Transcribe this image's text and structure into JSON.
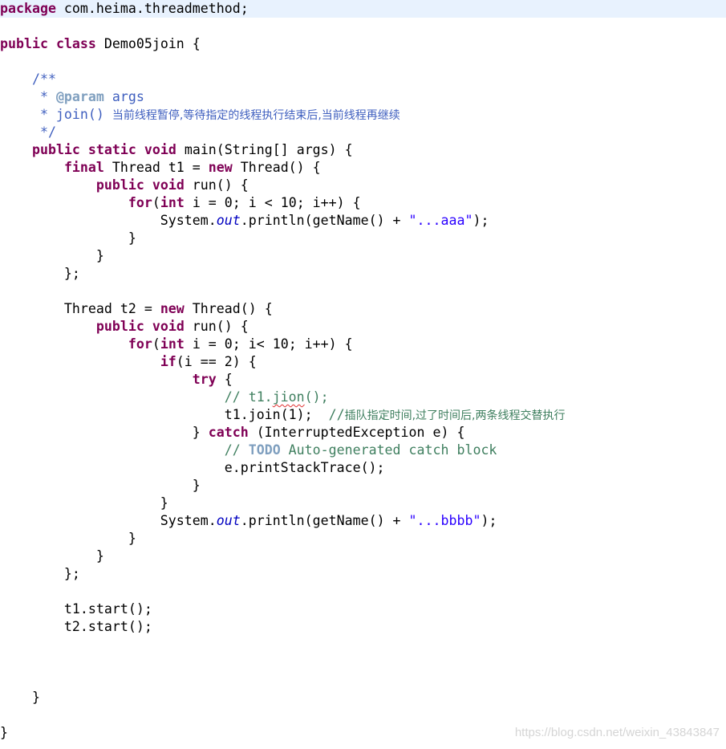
{
  "editor": {
    "lines": [
      {
        "highlight": true,
        "segs": [
          {
            "c": "kw",
            "t": "package"
          },
          {
            "c": "",
            "t": " com.heima.threadmethod;"
          }
        ]
      },
      {
        "segs": []
      },
      {
        "segs": [
          {
            "c": "kw",
            "t": "public"
          },
          {
            "c": "",
            "t": " "
          },
          {
            "c": "kw",
            "t": "class"
          },
          {
            "c": "",
            "t": " Demo05join {"
          }
        ]
      },
      {
        "segs": []
      },
      {
        "segs": [
          {
            "c": "jd",
            "t": "    /**"
          }
        ]
      },
      {
        "segs": [
          {
            "c": "jd",
            "t": "     * "
          },
          {
            "c": "tag",
            "t": "@param"
          },
          {
            "c": "jd",
            "t": " args"
          }
        ]
      },
      {
        "segs": [
          {
            "c": "jd",
            "t": "     * join() "
          },
          {
            "c": "jd cjk",
            "t": "当前线程暂停,等待指定的线程执行结束后,当前线程再继续"
          }
        ]
      },
      {
        "segs": [
          {
            "c": "jd",
            "t": "     */"
          }
        ]
      },
      {
        "segs": [
          {
            "c": "",
            "t": "    "
          },
          {
            "c": "kw",
            "t": "public"
          },
          {
            "c": "",
            "t": " "
          },
          {
            "c": "kw",
            "t": "static"
          },
          {
            "c": "",
            "t": " "
          },
          {
            "c": "kw",
            "t": "void"
          },
          {
            "c": "",
            "t": " main(String[] args) {"
          }
        ]
      },
      {
        "segs": [
          {
            "c": "",
            "t": "        "
          },
          {
            "c": "kw",
            "t": "final"
          },
          {
            "c": "",
            "t": " Thread t1 = "
          },
          {
            "c": "kw",
            "t": "new"
          },
          {
            "c": "",
            "t": " Thread() {"
          }
        ]
      },
      {
        "segs": [
          {
            "c": "",
            "t": "            "
          },
          {
            "c": "kw",
            "t": "public"
          },
          {
            "c": "",
            "t": " "
          },
          {
            "c": "kw",
            "t": "void"
          },
          {
            "c": "",
            "t": " run() {"
          }
        ]
      },
      {
        "segs": [
          {
            "c": "",
            "t": "                "
          },
          {
            "c": "kw",
            "t": "for"
          },
          {
            "c": "",
            "t": "("
          },
          {
            "c": "kw",
            "t": "int"
          },
          {
            "c": "",
            "t": " i = 0; i < 10; i++) {"
          }
        ]
      },
      {
        "segs": [
          {
            "c": "",
            "t": "                    System."
          },
          {
            "c": "fld",
            "t": "out"
          },
          {
            "c": "",
            "t": ".println(getName() + "
          },
          {
            "c": "str",
            "t": "\"...aaa\""
          },
          {
            "c": "",
            "t": ");"
          }
        ]
      },
      {
        "segs": [
          {
            "c": "",
            "t": "                }"
          }
        ]
      },
      {
        "segs": [
          {
            "c": "",
            "t": "            }"
          }
        ]
      },
      {
        "segs": [
          {
            "c": "",
            "t": "        };"
          }
        ]
      },
      {
        "segs": []
      },
      {
        "segs": [
          {
            "c": "",
            "t": "        Thread t2 = "
          },
          {
            "c": "kw",
            "t": "new"
          },
          {
            "c": "",
            "t": " Thread() {"
          }
        ]
      },
      {
        "segs": [
          {
            "c": "",
            "t": "            "
          },
          {
            "c": "kw",
            "t": "public"
          },
          {
            "c": "",
            "t": " "
          },
          {
            "c": "kw",
            "t": "void"
          },
          {
            "c": "",
            "t": " run() {"
          }
        ]
      },
      {
        "segs": [
          {
            "c": "",
            "t": "                "
          },
          {
            "c": "kw",
            "t": "for"
          },
          {
            "c": "",
            "t": "("
          },
          {
            "c": "kw",
            "t": "int"
          },
          {
            "c": "",
            "t": " i = 0; i< 10; i++) {"
          }
        ]
      },
      {
        "segs": [
          {
            "c": "",
            "t": "                    "
          },
          {
            "c": "kw",
            "t": "if"
          },
          {
            "c": "",
            "t": "(i == 2) {"
          }
        ]
      },
      {
        "segs": [
          {
            "c": "",
            "t": "                        "
          },
          {
            "c": "kw",
            "t": "try"
          },
          {
            "c": "",
            "t": " {"
          }
        ]
      },
      {
        "segs": [
          {
            "c": "",
            "t": "                            "
          },
          {
            "c": "cm",
            "t": "// t1."
          },
          {
            "c": "cm squiggle",
            "t": "jion"
          },
          {
            "c": "cm",
            "t": "();"
          }
        ]
      },
      {
        "segs": [
          {
            "c": "",
            "t": "                            t1.join(1);  "
          },
          {
            "c": "cm",
            "t": "//"
          },
          {
            "c": "cm cjk",
            "t": "插队指定时间,过了时间后,两条线程交替执行"
          }
        ]
      },
      {
        "segs": [
          {
            "c": "",
            "t": "                        } "
          },
          {
            "c": "kw",
            "t": "catch"
          },
          {
            "c": "",
            "t": " (InterruptedException e) {"
          }
        ]
      },
      {
        "segs": [
          {
            "c": "",
            "t": "                            "
          },
          {
            "c": "cm",
            "t": "// "
          },
          {
            "c": "todo",
            "t": "TODO"
          },
          {
            "c": "cm",
            "t": " Auto-generated catch block"
          }
        ]
      },
      {
        "segs": [
          {
            "c": "",
            "t": "                            e.printStackTrace();"
          }
        ]
      },
      {
        "segs": [
          {
            "c": "",
            "t": "                        }"
          }
        ]
      },
      {
        "segs": [
          {
            "c": "",
            "t": "                    }"
          }
        ]
      },
      {
        "segs": [
          {
            "c": "",
            "t": "                    System."
          },
          {
            "c": "fld",
            "t": "out"
          },
          {
            "c": "",
            "t": ".println(getName() + "
          },
          {
            "c": "str",
            "t": "\"...bbbb\""
          },
          {
            "c": "",
            "t": ");"
          }
        ]
      },
      {
        "segs": [
          {
            "c": "",
            "t": "                }"
          }
        ]
      },
      {
        "segs": [
          {
            "c": "",
            "t": "            }"
          }
        ]
      },
      {
        "segs": [
          {
            "c": "",
            "t": "        };"
          }
        ]
      },
      {
        "segs": []
      },
      {
        "segs": [
          {
            "c": "",
            "t": "        t1.start();"
          }
        ]
      },
      {
        "segs": [
          {
            "c": "",
            "t": "        t2.start();"
          }
        ]
      },
      {
        "segs": []
      },
      {
        "segs": []
      },
      {
        "segs": []
      },
      {
        "segs": [
          {
            "c": "",
            "t": "    }"
          }
        ]
      },
      {
        "segs": []
      },
      {
        "segs": [
          {
            "c": "",
            "t": "}"
          }
        ]
      }
    ]
  },
  "watermark": "https://blog.csdn.net/weixin_43843847"
}
